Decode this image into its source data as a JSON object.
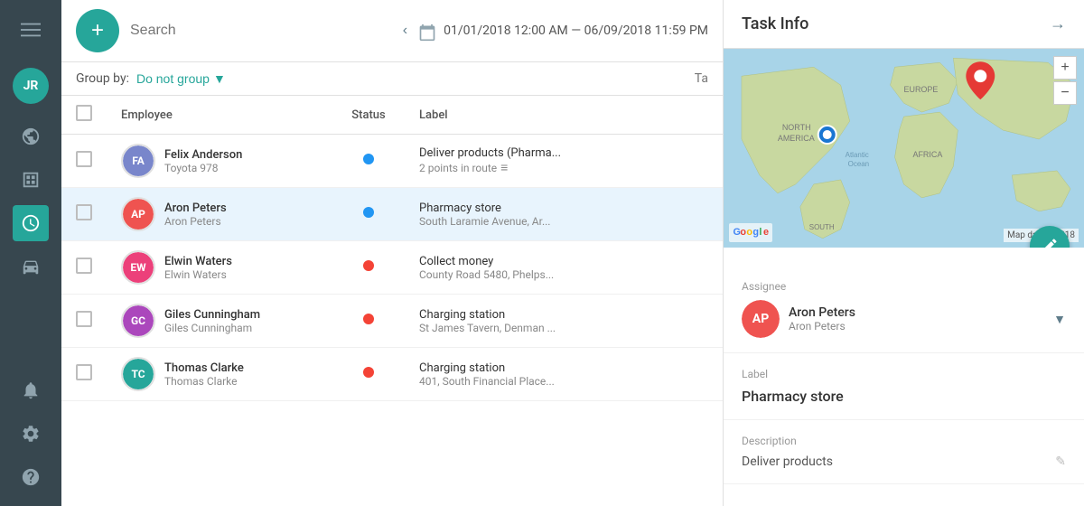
{
  "sidebar": {
    "avatar": "JR",
    "menu_icon": "☰",
    "icons": [
      {
        "name": "globe-icon",
        "symbol": "🌐",
        "active": false
      },
      {
        "name": "table-icon",
        "symbol": "▦",
        "active": false
      },
      {
        "name": "clock-icon",
        "symbol": "⏱",
        "active": true
      },
      {
        "name": "car-icon",
        "symbol": "🚗",
        "active": false
      },
      {
        "name": "bell-icon",
        "symbol": "🔔",
        "active": false
      },
      {
        "name": "gear-icon",
        "symbol": "⚙",
        "active": false
      },
      {
        "name": "help-icon",
        "symbol": "?",
        "active": false
      }
    ]
  },
  "header": {
    "search_placeholder": "Search",
    "date_range": "01/01/2018 12:00 AM — 06/09/2018 11:59 PM",
    "add_button_label": "+"
  },
  "toolbar": {
    "group_by_label": "Group by:",
    "group_by_value": "Do not group",
    "tab_label": "Ta"
  },
  "table": {
    "columns": [
      "",
      "Employee",
      "Status",
      "Label",
      ""
    ],
    "rows": [
      {
        "id": 1,
        "employee_name": "Felix Anderson",
        "employee_sub": "Toyota 978",
        "avatar_color": "#7986cb",
        "avatar_initials": "FA",
        "status": "blue",
        "label_title": "Deliver products (Pharma...",
        "label_sub": "2 points in route",
        "has_list_icon": true,
        "selected": false
      },
      {
        "id": 2,
        "employee_name": "Aron Peters",
        "employee_sub": "Aron Peters",
        "avatar_color": "#ef5350",
        "avatar_initials": "AP",
        "status": "blue",
        "label_title": "Pharmacy store",
        "label_sub": "South Laramie Avenue, Ar...",
        "has_list_icon": false,
        "selected": true
      },
      {
        "id": 3,
        "employee_name": "Elwin Waters",
        "employee_sub": "Elwin Waters",
        "avatar_color": "#ec407a",
        "avatar_initials": "EW",
        "status": "red",
        "label_title": "Collect money",
        "label_sub": "County Road 5480, Phelps...",
        "has_list_icon": false,
        "selected": false
      },
      {
        "id": 4,
        "employee_name": "Giles Cunningham",
        "employee_sub": "Giles Cunningham",
        "avatar_color": "#ab47bc",
        "avatar_initials": "GC",
        "status": "red",
        "label_title": "Charging station",
        "label_sub": "St James Tavern, Denman ...",
        "has_list_icon": false,
        "selected": false
      },
      {
        "id": 5,
        "employee_name": "Thomas Clarke",
        "employee_sub": "Thomas Clarke",
        "avatar_color": "#26a69a",
        "avatar_initials": "TC",
        "status": "red",
        "label_title": "Charging station",
        "label_sub": "401, South Financial Place...",
        "has_list_icon": false,
        "selected": false
      }
    ]
  },
  "panel": {
    "title": "Task Info",
    "close_label": "→",
    "map": {
      "zoom_in": "+",
      "zoom_out": "−",
      "logo": "Google",
      "attribution": "Map data ©2018"
    },
    "edit_icon": "✎",
    "assignee_section_label": "Assignee",
    "assignee_name": "Aron Peters",
    "assignee_sub": "Aron Peters",
    "label_section_label": "Label",
    "label_value": "Pharmacy store",
    "description_section_label": "Description",
    "description_text": "Deliver products",
    "edit_description_icon": "✎"
  }
}
